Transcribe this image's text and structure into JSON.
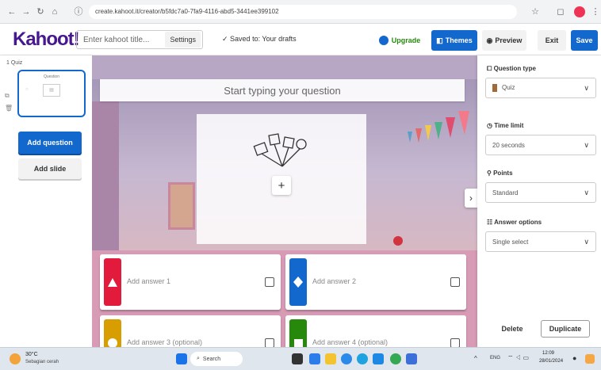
{
  "browser": {
    "url": "create.kahoot.it/creator/b5fdc7a0-7fa9-4116-abd5-3441ee399102"
  },
  "app": {
    "logo": "Kahoot!",
    "title_placeholder": "Enter kahoot title...",
    "settings_label": "Settings",
    "saved_status": "Saved to: Your drafts",
    "upgrade_label": "Upgrade",
    "themes_label": "Themes",
    "preview_label": "Preview",
    "exit_label": "Exit",
    "save_label": "Save"
  },
  "left_panel": {
    "slide_number": "1",
    "slide_type": "Quiz",
    "thumb_title": "Question",
    "add_question_label": "Add question",
    "add_slide_label": "Add slide"
  },
  "editor": {
    "question_placeholder": "Start typing your question",
    "media_add": "+",
    "next": "›",
    "answers": [
      {
        "label": "Add answer 1",
        "color": "#e21b3c",
        "shape": "triangle"
      },
      {
        "label": "Add answer 2",
        "color": "#1368ce",
        "shape": "diamond"
      },
      {
        "label": "Add answer 3 (optional)",
        "color": "#d89e00",
        "shape": "circle"
      },
      {
        "label": "Add answer 4 (optional)",
        "color": "#26890c",
        "shape": "square"
      }
    ]
  },
  "right_panel": {
    "question_type_label": "Question type",
    "question_type_value": "Quiz",
    "time_limit_label": "Time limit",
    "time_limit_value": "20 seconds",
    "points_label": "Points",
    "points_value": "Standard",
    "answer_options_label": "Answer options",
    "answer_options_value": "Single select",
    "delete_label": "Delete",
    "duplicate_label": "Duplicate"
  },
  "taskbar": {
    "weather_temp": "30°C",
    "weather_desc": "Sebagian cerah",
    "search_label": "Search",
    "lang": "ENG",
    "time": "12:09",
    "date": "28/01/2024"
  },
  "colors": {
    "kahoot_purple": "#46178f",
    "blue": "#1368ce",
    "red": "#e21b3c",
    "yellow": "#d89e00",
    "green": "#26890c"
  }
}
